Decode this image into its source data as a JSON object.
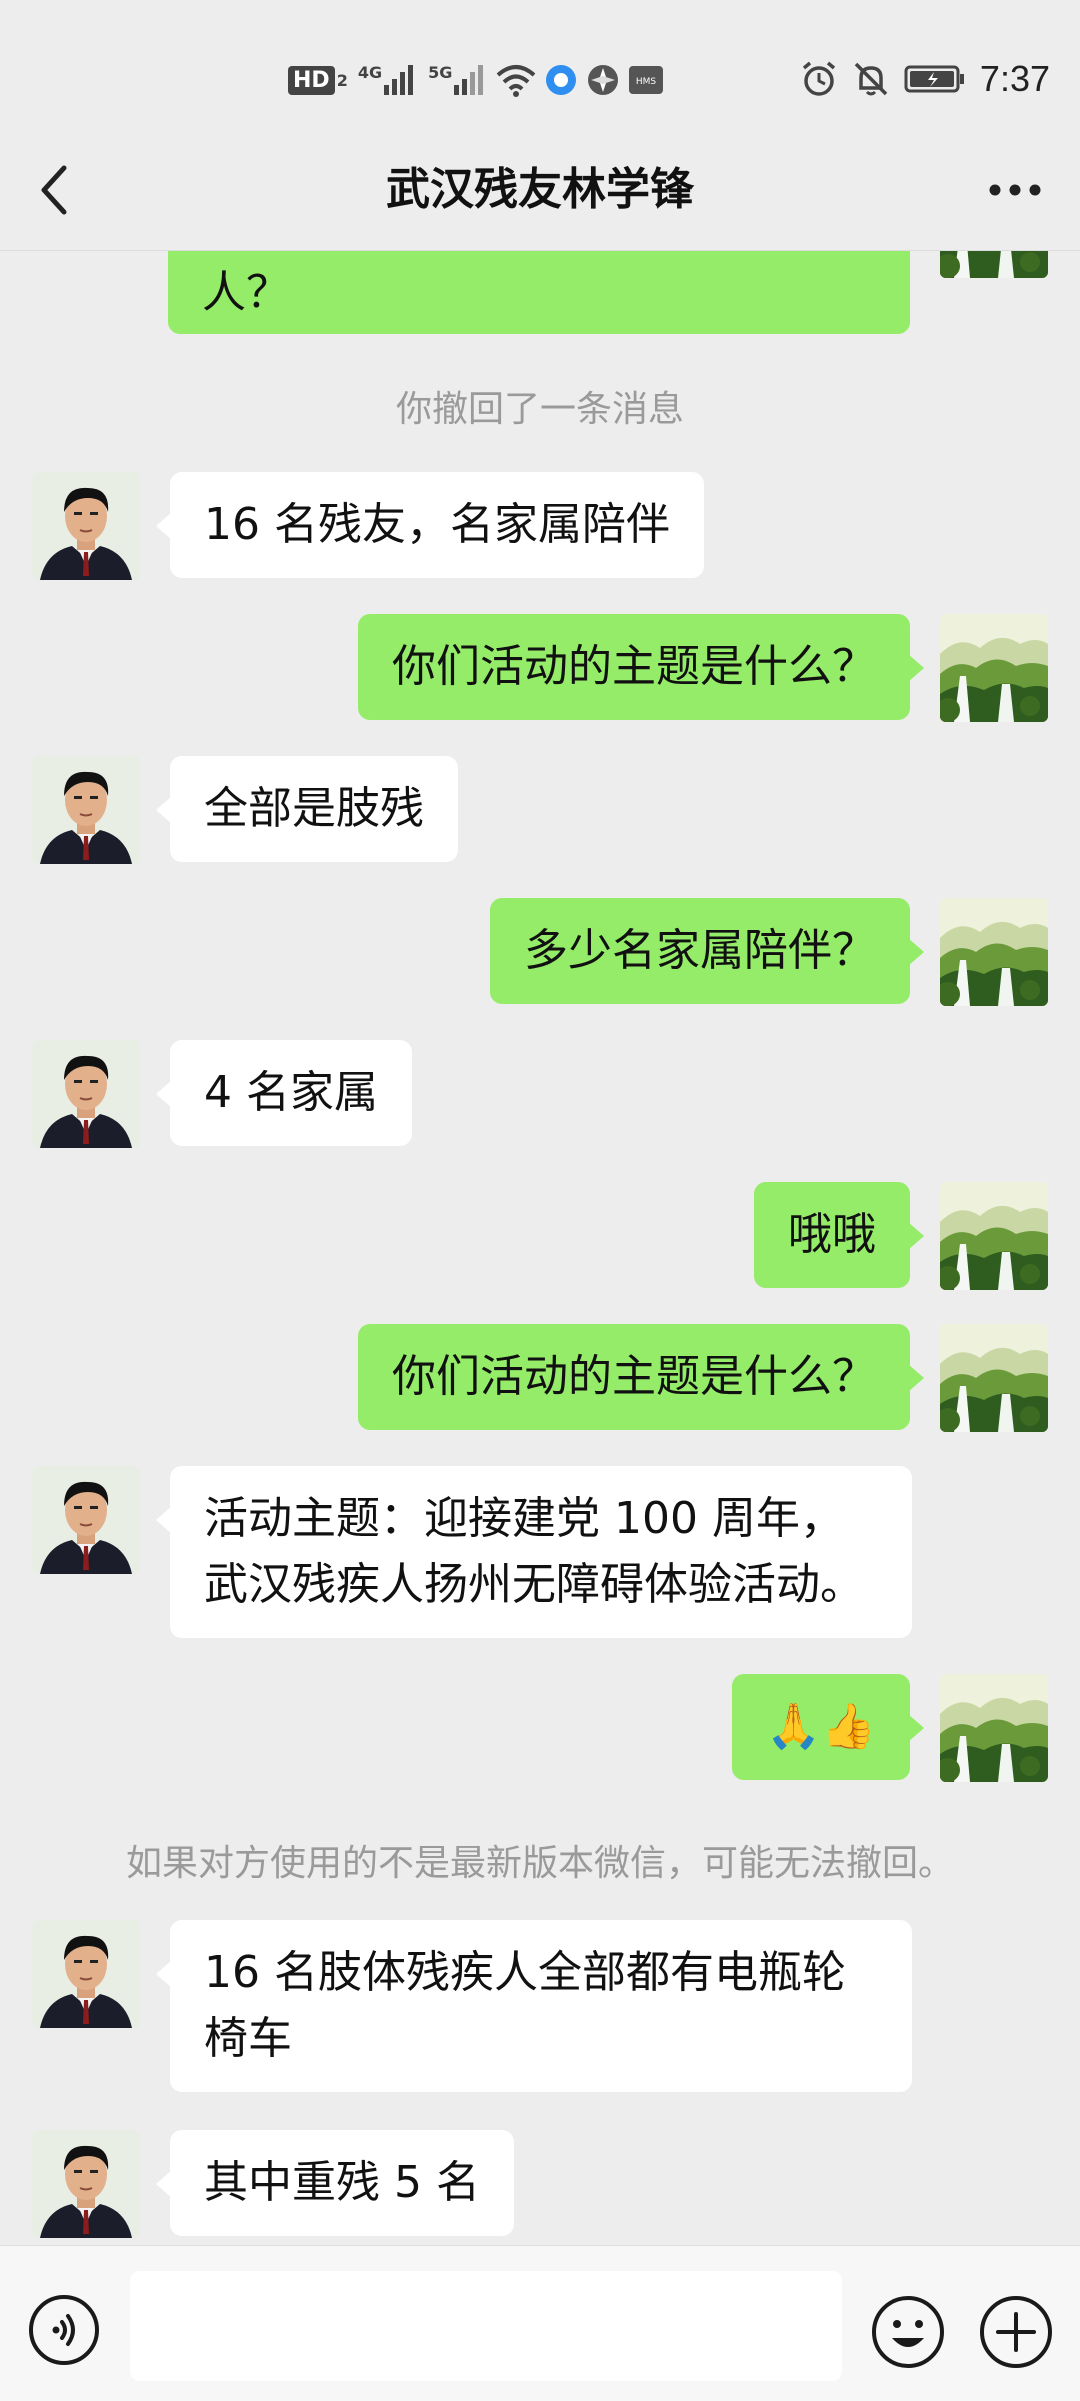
{
  "status_bar": {
    "hd_label": "HD",
    "hd_sub": "2",
    "net1": "4G",
    "net2": "5G",
    "hms_label": "HMS",
    "time": "7:37"
  },
  "header": {
    "title": "武汉残友林学锋"
  },
  "messages": [
    {
      "type": "out",
      "text": "人？"
    },
    {
      "type": "system",
      "text": "你撤回了一条消息"
    },
    {
      "type": "in",
      "text": "16 名残友，名家属陪伴"
    },
    {
      "type": "out",
      "text": "你们活动的主题是什么？"
    },
    {
      "type": "in",
      "text": "全部是肢残"
    },
    {
      "type": "out",
      "text": "多少名家属陪伴？"
    },
    {
      "type": "in",
      "text": "4 名家属"
    },
    {
      "type": "out",
      "text": "哦哦"
    },
    {
      "type": "out",
      "text": "你们活动的主题是什么？"
    },
    {
      "type": "in",
      "text": "活动主题：迎接建党 100 周年，武汉残疾人扬州无障碍体验活动。"
    },
    {
      "type": "out",
      "text": "🙏👍"
    },
    {
      "type": "system",
      "text": "如果对方使用的不是最新版本微信，可能无法撤回。"
    },
    {
      "type": "in",
      "text": "16 名肢体残疾人全部都有电瓶轮椅车"
    },
    {
      "type": "in",
      "text": "其中重残 5 名"
    }
  ],
  "input": {
    "value": "",
    "placeholder": ""
  },
  "colors": {
    "background": "#ededed",
    "outgoing_bubble": "#95ec69",
    "incoming_bubble": "#ffffff",
    "system_text": "#9a9a9a"
  },
  "icons": {
    "back": "chevron-left-icon",
    "more": "more-dots-icon",
    "voice": "voice-icon",
    "emoji": "emoji-icon",
    "plus": "plus-icon"
  }
}
